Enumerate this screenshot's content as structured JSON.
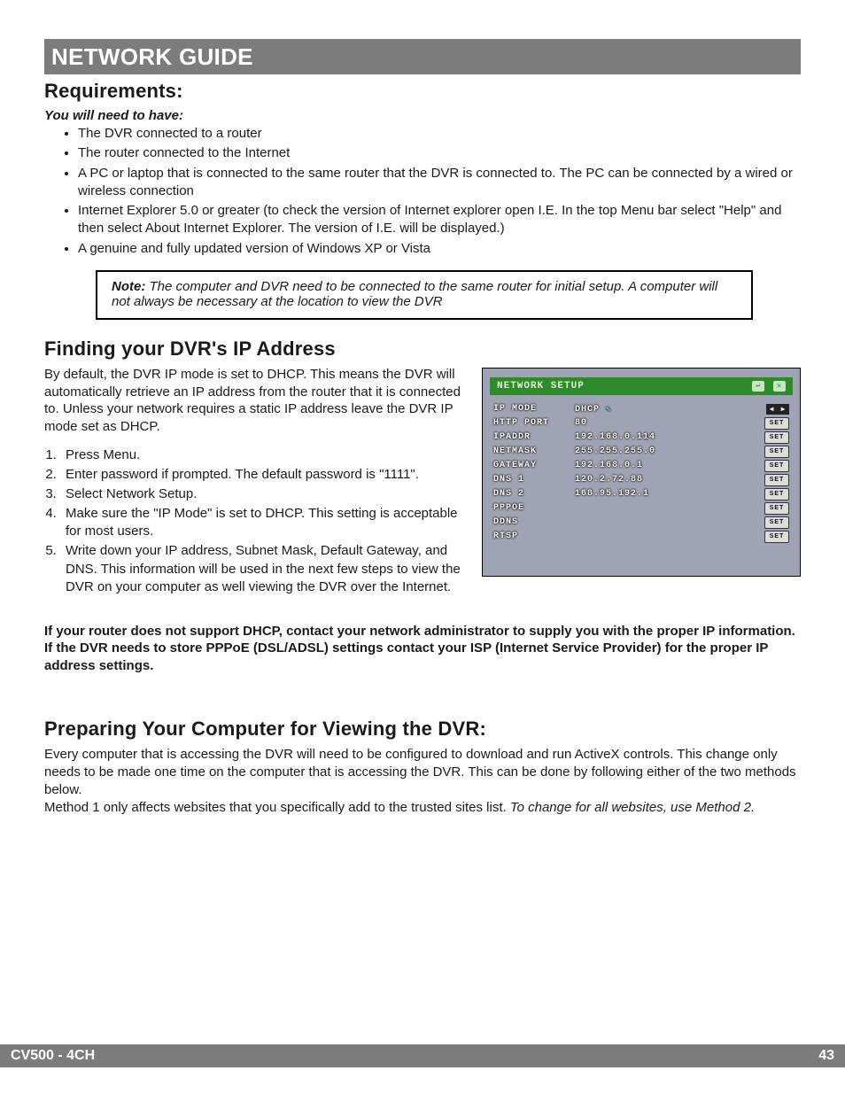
{
  "header": {
    "title": "NETWORK GUIDE"
  },
  "requirements": {
    "heading": "Requirements:",
    "need": "You will need to have:",
    "items": [
      "The DVR connected to a router",
      "The router connected to the Internet",
      "A PC or laptop that is connected to the same router that the DVR is connected to. The PC can be connected by a wired or wireless connection",
      "Internet Explorer 5.0 or greater (to check the version of Internet explorer open I.E. In the top Menu bar select \"Help\" and then select About Internet Explorer. The version of I.E. will be displayed.)",
      "A genuine and fully updated version of Windows XP or Vista"
    ]
  },
  "note": {
    "label": "Note:  ",
    "text": "The computer and DVR need to be connected to the same router for initial setup. A computer will not always be necessary at the location to view the DVR"
  },
  "finding": {
    "heading": "Finding your DVR's IP Address",
    "intro": "By default, the DVR IP mode is set to DHCP. This means the DVR will automatically retrieve an IP address from the router that it is connected to. Unless your network requires a static IP address leave the DVR IP mode set as DHCP.",
    "steps": [
      "Press Menu.",
      "Enter password if prompted. The default password is \"1111\".",
      "Select Network Setup.",
      "Make sure the \"IP Mode\" is set to DHCP. This setting is acceptable for most users.",
      "Write down your IP address, Subnet Mask, Default Gateway, and DNS. This information will be used in the next few steps to view the DVR on your computer as well viewing the DVR over the Internet."
    ],
    "router_note": "If your router does not support DHCP, contact your network administrator to supply you with the proper IP information. If the DVR needs to store PPPoE (DSL/ADSL) settings contact your ISP (Internet Service Provider) for the proper IP address settings."
  },
  "preparing": {
    "heading": "Preparing Your Computer for Viewing the DVR:",
    "p1": "Every computer that is accessing the DVR will need to be configured to download and run ActiveX controls. This change only needs to be made one time on the computer that is accessing the DVR. This can be done by following either of the two methods below.",
    "p2a": "Method 1 only affects websites that you specifically add to the trusted sites list. ",
    "p2b": "To change for all websites, use Method 2."
  },
  "screenshot": {
    "title": "NETWORK SETUP",
    "rows": [
      {
        "label": "IP MODE",
        "value": "DHCP",
        "control": "arrows"
      },
      {
        "label": "HTTP PORT",
        "value": "80",
        "control": "set"
      },
      {
        "label": "IPADDR",
        "value": "192.168.0.114",
        "control": "set"
      },
      {
        "label": "NETMASK",
        "value": "255.255.255.0",
        "control": "set"
      },
      {
        "label": "GATEWAY",
        "value": "192.168.0.1",
        "control": "set"
      },
      {
        "label": "DNS 1",
        "value": "120.2.72.88",
        "control": "set"
      },
      {
        "label": "DNS 2",
        "value": "168.95.192.1",
        "control": "set"
      },
      {
        "label": "PPPOE",
        "value": "",
        "control": "set"
      },
      {
        "label": "DDNS",
        "value": "",
        "control": "set"
      },
      {
        "label": "RTSP",
        "value": "",
        "control": "set"
      }
    ],
    "set_label": "SET"
  },
  "footer": {
    "model": "CV500 - 4CH",
    "page": "43"
  }
}
